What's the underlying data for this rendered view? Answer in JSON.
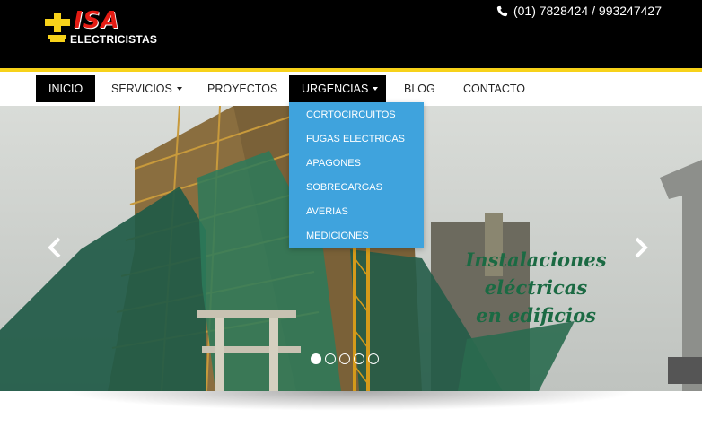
{
  "brand": {
    "name": "ISA",
    "subtitle": "ELECTRICISTAS"
  },
  "header": {
    "phone": "(01) 7828424 / 993247427",
    "phone_icon": "phone-icon"
  },
  "nav": {
    "items": [
      {
        "label": "INICIO",
        "active": true
      },
      {
        "label": "SERVICIOS",
        "dropdown": true
      },
      {
        "label": "PROYECTOS"
      },
      {
        "label": "URGENCIAS",
        "dropdown": true,
        "open": true
      },
      {
        "label": "BLOG"
      },
      {
        "label": "CONTACTO"
      }
    ]
  },
  "dropdown": {
    "items": [
      "CORTOCIRCUITOS",
      "FUGAS ELECTRICAS",
      "APAGONES",
      "SOBRECARGAS",
      "AVERIAS",
      "MEDICIONES"
    ]
  },
  "slider": {
    "title_line1": "Instalaciones eléctricas",
    "title_line2": "en edificios",
    "slide_count": 5,
    "active_slide": 1,
    "prev_icon": "chevron-left-icon",
    "next_icon": "chevron-right-icon"
  },
  "colors": {
    "header_bg": "#000000",
    "accent_yellow": "#f7d21a",
    "brand_red": "#e41b13",
    "dropdown_bg": "#3fa3dd",
    "title_green": "#1b6a43"
  }
}
